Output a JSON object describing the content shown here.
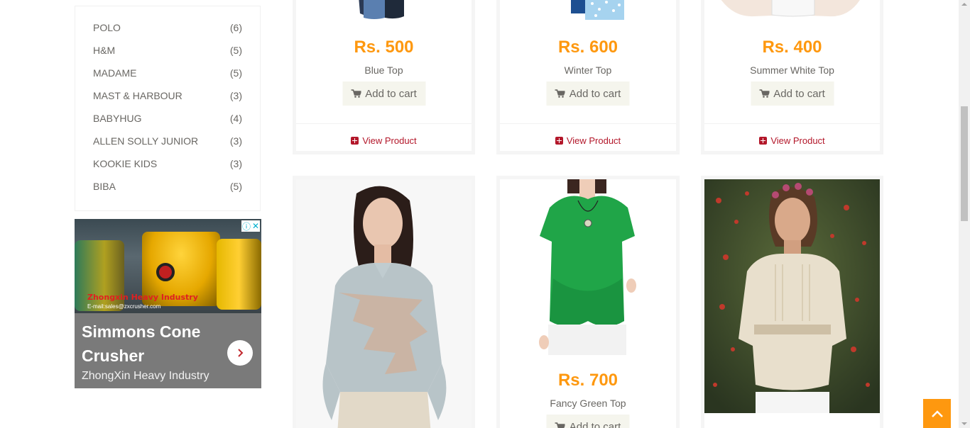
{
  "sidebar": {
    "brands": [
      {
        "name": "POLO",
        "count": "(6)"
      },
      {
        "name": "H&M",
        "count": "(5)"
      },
      {
        "name": "MADAME",
        "count": "(5)"
      },
      {
        "name": "MAST & HARBOUR",
        "count": "(3)"
      },
      {
        "name": "BABYHUG",
        "count": "(4)"
      },
      {
        "name": "ALLEN SOLLY JUNIOR",
        "count": "(3)"
      },
      {
        "name": "KOOKIE KIDS",
        "count": "(3)"
      },
      {
        "name": "BIBA",
        "count": "(5)"
      }
    ]
  },
  "ad": {
    "title": "Simmons Cone Crusher",
    "advertiser": "ZhongXin Heavy Industry",
    "image_brand": "Zhongxin Heavy Industry",
    "image_email": "E-mail:sales@zxcrusher.com",
    "info_icon": "info-icon",
    "close_icon": "close-icon",
    "arrow_icon": "chevron-right-icon"
  },
  "products": [
    {
      "price": "Rs. 500",
      "name": "Blue Top",
      "cart": "Add to cart",
      "view": "View Product"
    },
    {
      "price": "Rs. 600",
      "name": "Winter Top",
      "cart": "Add to cart",
      "view": "View Product"
    },
    {
      "price": "Rs. 400",
      "name": "Summer White Top",
      "cart": "Add to cart",
      "view": "View Product"
    },
    {
      "price": "",
      "name": "",
      "cart": "",
      "view": ""
    },
    {
      "price": "Rs. 700",
      "name": "Fancy Green Top",
      "cart": "Add to cart",
      "view": ""
    },
    {
      "price": "",
      "name": "",
      "cart": "",
      "view": ""
    }
  ],
  "colors": {
    "accent": "#fe980f",
    "link": "#b3172a",
    "text": "#696763",
    "button_bg": "#f5f5ed"
  },
  "scroll_to_top_icon": "chevron-up-icon"
}
